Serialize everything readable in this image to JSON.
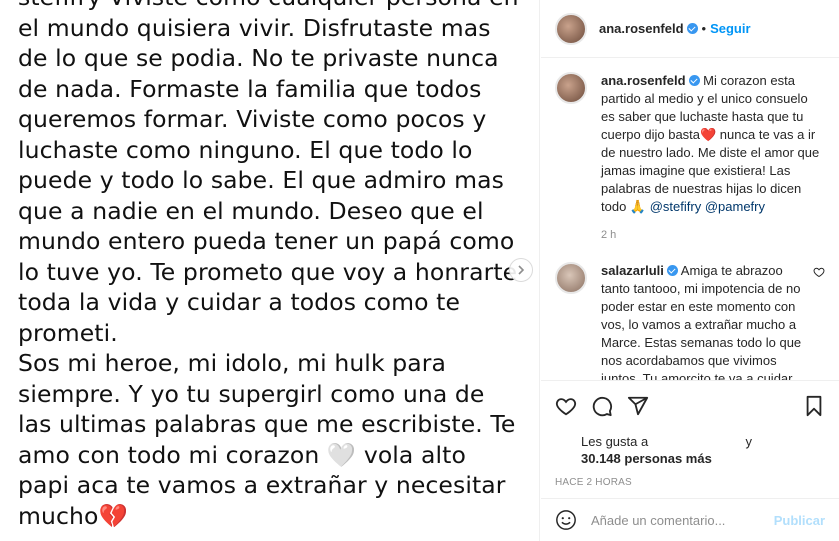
{
  "post_image": {
    "paragraph1": "stefifry Viviste como cualquier persona en el mundo quisiera vivir. Disfrutaste mas de lo que se podia. No te privaste nunca de nada. Formaste la familia que todos queremos formar. Viviste como pocos y luchaste como ninguno. El que todo lo puede y todo lo sabe. El que admiro mas que a nadie en el mundo. Deseo que el mundo entero pueda tener un papá como lo tuve yo. Te prometo que voy a honrarte toda la vida y cuidar a todos como te prometi.",
    "paragraph2": "Sos mi heroe, mi idolo, mi hulk para siempre. Y yo tu supergirl como una de las ultimas palabras que me escribiste. Te amo con todo mi corazon 🤍 vola alto papi aca te vamos a extrañar y necesitar mucho💔",
    "next_icon": "chevron-right-icon"
  },
  "header": {
    "username": "ana.rosenfeld",
    "separator": "•",
    "follow_label": "Seguir"
  },
  "caption": {
    "username": "ana.rosenfeld",
    "text": "Mi corazon esta partido al medio y el unico consuelo es saber que luchaste hasta que tu cuerpo dijo basta❤️ nunca te vas a ir de nuestro lado. Me diste el amor que jamas imagine que existiera! Las palabras de nuestras hijas lo dicen todo 🙏",
    "mention1": "@stefifry",
    "mention2": "@pamefry",
    "time": "2 h"
  },
  "comment": {
    "username": "salazarluli",
    "text": "Amiga te abrazoo tanto tantooo, mi impotencia de no poder estar en este momento con vos, lo vamos a extrañar mucho a Marce. Estas semanas todo lo que nos acordabamos que vivimos juntos. Tu amorcito te va a cuidar desde el cielo siempre como lo"
  },
  "actions": {
    "likes_prefix": "Les gusta a",
    "likes_and": "y",
    "likes_count": "30.148 personas más",
    "posted": "HACE 2 HORAS"
  },
  "add_comment": {
    "placeholder": "Añade un comentario...",
    "publish_label": "Publicar"
  },
  "colors": {
    "accent": "#0095f6",
    "verified": "#3897f0",
    "mention": "#00376b",
    "muted": "#8e8e8e"
  }
}
